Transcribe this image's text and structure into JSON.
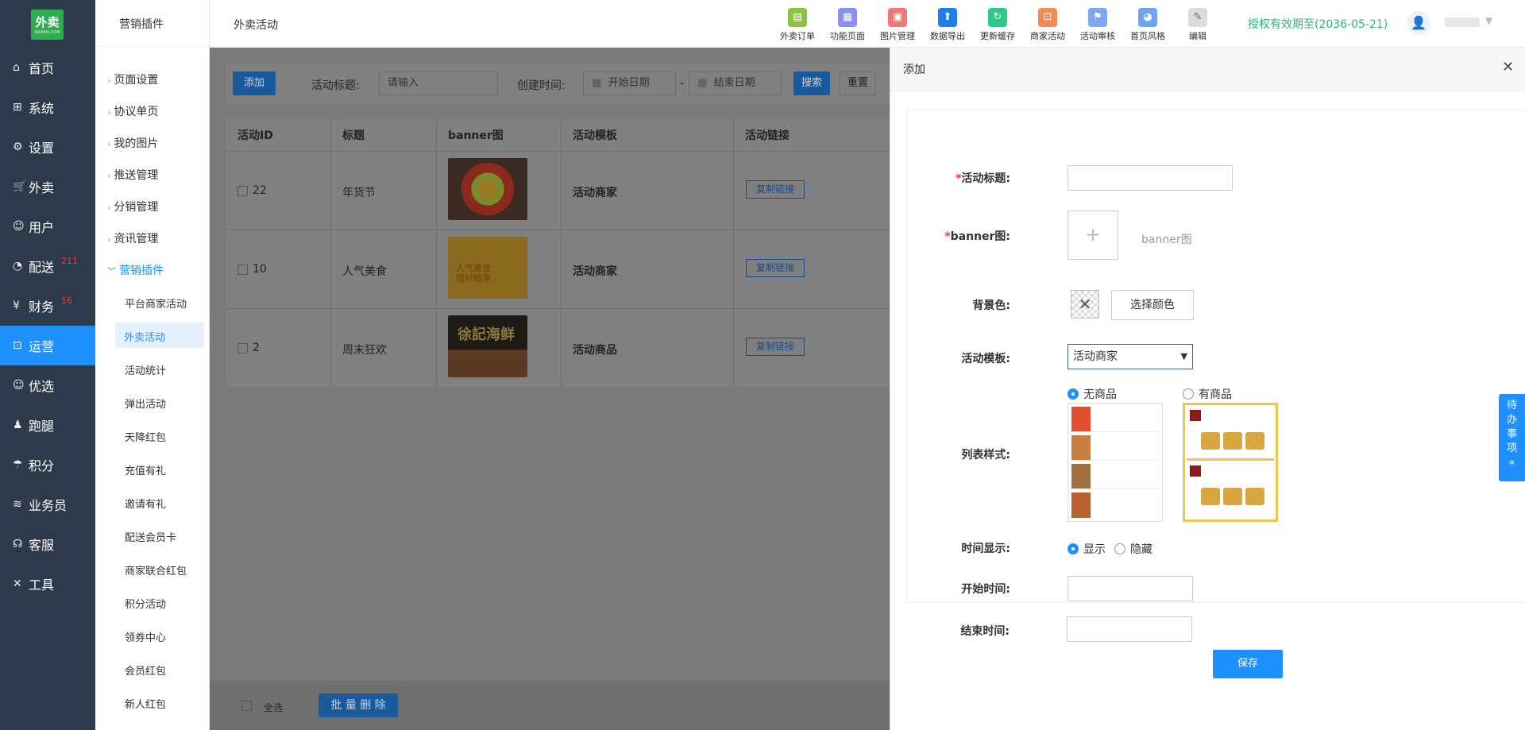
{
  "sidebar": {
    "logo": "外卖",
    "logo_sub": "WAIMAI.COM",
    "items": [
      {
        "label": "首页",
        "icon": "home-icon"
      },
      {
        "label": "系统",
        "icon": "windows-icon"
      },
      {
        "label": "设置",
        "icon": "gear-icon"
      },
      {
        "label": "外卖",
        "icon": "cart-icon"
      },
      {
        "label": "用户",
        "icon": "user-icon"
      },
      {
        "label": "配送",
        "icon": "speedometer-icon",
        "badge": "211"
      },
      {
        "label": "财务",
        "icon": "yen-icon",
        "badge": "16"
      },
      {
        "label": "运营",
        "icon": "gift-icon",
        "active": true
      },
      {
        "label": "优选",
        "icon": "smile-icon"
      },
      {
        "label": "跑腿",
        "icon": "person-icon"
      },
      {
        "label": "积分",
        "icon": "umbrella-icon"
      },
      {
        "label": "业务员",
        "icon": "layers-icon"
      },
      {
        "label": "客服",
        "icon": "headset-icon"
      },
      {
        "label": "工具",
        "icon": "tools-icon"
      }
    ]
  },
  "subnav": {
    "title": "营销插件",
    "groups": [
      "页面设置",
      "协议单页",
      "我的图片",
      "推送管理",
      "分销管理",
      "资讯管理",
      "营销插件"
    ],
    "items": [
      "平台商家活动",
      "外卖活动",
      "活动统计",
      "弹出活动",
      "天降红包",
      "充值有礼",
      "邀请有礼",
      "配送会员卡",
      "商家联合红包",
      "积分活动",
      "领券中心",
      "会员红包",
      "新人红包"
    ],
    "selected": "外卖活动"
  },
  "header": {
    "breadcrumb": "外卖活动",
    "tools": [
      {
        "label": "外卖订单",
        "icon": "order-icon",
        "color": "#8cc43f"
      },
      {
        "label": "功能页面",
        "icon": "grid-icon",
        "color": "#8a8ff0"
      },
      {
        "label": "图片管理",
        "icon": "image-icon",
        "color": "#f07878"
      },
      {
        "label": "数据导出",
        "icon": "upload-icon",
        "color": "#1e7fe8"
      },
      {
        "label": "更新缓存",
        "icon": "refresh-icon",
        "color": "#2ec98a"
      },
      {
        "label": "商家活动",
        "icon": "gift-icon",
        "color": "#f28b55"
      },
      {
        "label": "活动审核",
        "icon": "flag-icon",
        "color": "#7ea6f2"
      },
      {
        "label": "首页风格",
        "icon": "palette-icon",
        "color": "#6fa4f2"
      },
      {
        "label": "编辑",
        "icon": "pencil-icon",
        "color": "#dcdcdc"
      }
    ],
    "license": "授权有效期至(2036-05-21)"
  },
  "filter": {
    "add_label": "添加",
    "title_label": "活动标题:",
    "title_placeholder": "请输入",
    "time_label": "创建时间:",
    "start_placeholder": "开始日期",
    "end_placeholder": "结束日期",
    "dash": "-",
    "search_label": "搜索",
    "reset_label": "重置"
  },
  "table": {
    "headers": [
      "活动ID",
      "标题",
      "banner图",
      "活动模板",
      "活动链接"
    ],
    "rows": [
      {
        "id": "22",
        "title": "年货节",
        "template": "活动商家",
        "link": "复制链接"
      },
      {
        "id": "10",
        "title": "人气美食",
        "template": "活动商家",
        "link": "复制链接"
      },
      {
        "id": "2",
        "title": "周末狂欢",
        "template": "活动商品",
        "link": "复制链接"
      }
    ],
    "banner2_text": "人气美食",
    "banner2_sub": "限时畅享",
    "banner3_text": "徐記海鲜"
  },
  "footer": {
    "select_all": "全选",
    "batch_delete": "批 量 删 除"
  },
  "panel": {
    "title": "添加",
    "fields": {
      "title_label": "活动标题:",
      "banner_label": "banner图:",
      "banner_hint": "banner图",
      "bg_label": "背景色:",
      "choose_color": "选择颜色",
      "template_label": "活动模板:",
      "template_value": "活动商家",
      "list_label": "列表样式:",
      "no_goods": "无商品",
      "has_goods": "有商品",
      "time_display_label": "时间显示:",
      "show": "显示",
      "hide": "隐藏",
      "start_label": "开始时间:",
      "end_label": "结束时间:"
    },
    "save": "保存"
  },
  "todo": "待办事项"
}
